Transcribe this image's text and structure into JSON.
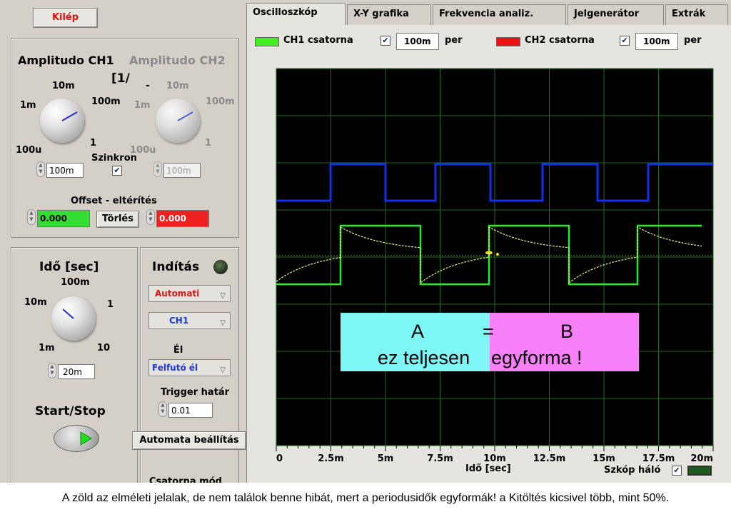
{
  "exit_button": "Kilép",
  "amplitude": {
    "ch1_title": "Amplitudo CH1",
    "ch2_title": "Amplitudo CH2",
    "unit_fragment": "[1/",
    "ch1_ticks": [
      "10m",
      "1m",
      "100m",
      "100u",
      "1"
    ],
    "ch2_ticks": [
      "10m",
      "1m",
      "100m",
      "100u",
      "1"
    ],
    "sync_label": "Szinkron",
    "sync_checked": true,
    "ch1_value": "100m",
    "ch2_value": "100m"
  },
  "offset": {
    "label": "Offset - eltérítés",
    "ch1_value": "0.000",
    "ch2_value": "0.000",
    "clear_button": "Törlés",
    "ch1_color": "#33dd33",
    "ch2_color": "#ee2020"
  },
  "time": {
    "title": "Idő [sec]",
    "ticks": [
      "100m",
      "10m",
      "1",
      "1m",
      "10"
    ],
    "value": "20m"
  },
  "trigger": {
    "title": "Indítás",
    "mode": "Automati",
    "source": "CH1",
    "edge_label": "Él",
    "edge": "Felfutó él",
    "level_label": "Trigger határ",
    "level_value": "0.01",
    "auto_setup_button": "Automata beállítás",
    "channel_mode_label": "Csatorna mód"
  },
  "start_stop_label": "Start/Stop",
  "tabs": [
    "Oscilloszkóp",
    "X-Y grafika",
    "Frekvencia analiz.",
    "Jelgenerátor",
    "Extrák"
  ],
  "active_tab": 0,
  "ch1": {
    "label": "CH1 csatorna",
    "checked": true,
    "scale": "100m",
    "unit": "per",
    "color": "#44ee22"
  },
  "ch2": {
    "label": "CH2 csatorna",
    "checked": true,
    "scale": "100m",
    "unit": "per",
    "color": "#ee1111"
  },
  "scope": {
    "x_ticks": [
      "0",
      "2.5m",
      "5m",
      "7.5m",
      "10m",
      "12.5m",
      "15m",
      "17.5m",
      "20m"
    ],
    "x_label": "Idő [sec]",
    "grid_label": "Szkóp háló",
    "grid_checked": true,
    "background": "#000000",
    "grid_color": "#1f6b1f",
    "blue_color": "#1030ee",
    "green_color": "#22ee22",
    "trace_color": "#d8e080"
  },
  "annotation": {
    "a": "A",
    "eq": "=",
    "b": "B",
    "left_text": "ez teljesen",
    "right_text": "egyforma !",
    "left_color": "#7ef6f6",
    "right_color": "#f77ff7"
  },
  "caption": "A zöld az elméleti jelalak, de nem találok benne hibát, mert a periodusidők egyformák! a Kitöltés kicsivel több, mint 50%."
}
